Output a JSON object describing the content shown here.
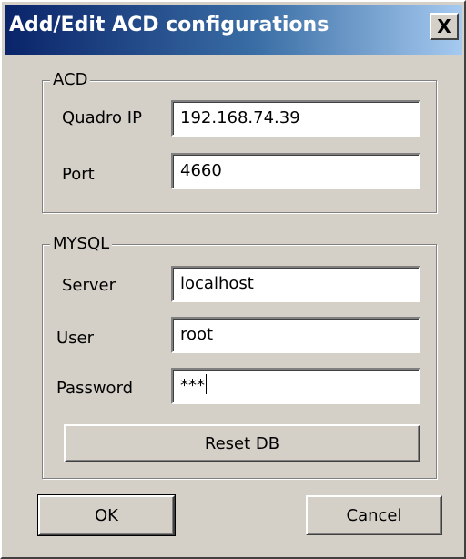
{
  "window": {
    "title": "Add/Edit ACD configurations",
    "close_glyph": "X"
  },
  "acd": {
    "legend": "ACD",
    "quadro_ip_label": "Quadro IP",
    "quadro_ip_value": "192.168.74.39",
    "port_label": "Port",
    "port_value": "4660"
  },
  "mysql": {
    "legend": "MYSQL",
    "server_label": "Server",
    "server_value": "localhost",
    "user_label": "User",
    "user_value": "root",
    "password_label": "Password",
    "password_value": "***",
    "reset_label": "Reset DB"
  },
  "buttons": {
    "ok_label": "OK",
    "cancel_label": "Cancel"
  },
  "colors": {
    "title_gradient_start": "#0a246a",
    "title_gradient_end": "#a6caf0",
    "dialog_face": "#d4d0c8"
  },
  "icons": {
    "close": "close-icon"
  }
}
